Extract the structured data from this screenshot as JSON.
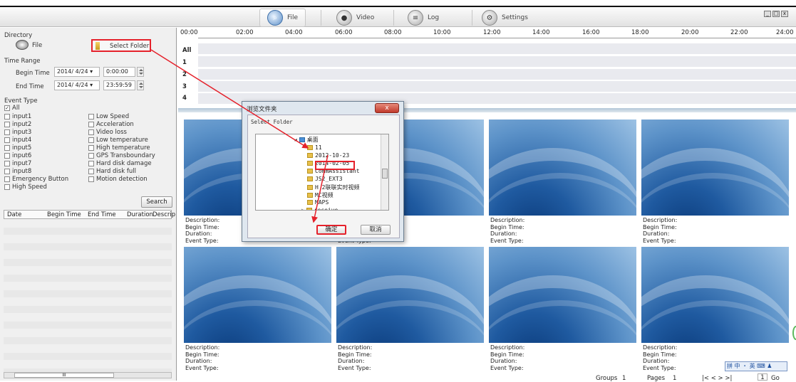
{
  "toolbar": {
    "tabs": [
      {
        "label": "File",
        "active": true
      },
      {
        "label": "Video"
      },
      {
        "label": "Log"
      },
      {
        "label": "Settings"
      }
    ]
  },
  "left": {
    "directory_label": "Directory",
    "file_label": "File",
    "select_folder": "Select Folder",
    "time_range_label": "Time Range",
    "begin_label": "Begin Time",
    "begin_date": "2014/ 4/24",
    "begin_time": "0:00:00",
    "end_label": "End Time",
    "end_date": "2014/ 4/24",
    "end_time": "23:59:59",
    "event_type_label": "Event Type",
    "all": "All",
    "events_col1": [
      "input1",
      "input2",
      "input3",
      "input4",
      "input5",
      "input6",
      "input7",
      "input8",
      "Emergency Button",
      "High Speed"
    ],
    "events_col2": [
      "Low Speed",
      "Acceleration",
      "Video loss",
      "Low temperature",
      "High temperature",
      "GPS Transboundary",
      "Hard disk damage",
      "Hard disk full",
      "Motion detection"
    ],
    "search": "Search",
    "table_headers": [
      "Date",
      "Begin Time",
      "End Time",
      "Duration",
      "Descrip"
    ],
    "scroll_mark": "III"
  },
  "timeline": {
    "ticks": [
      "00:00",
      "02:00",
      "04:00",
      "06:00",
      "08:00",
      "10:00",
      "12:00",
      "14:00",
      "16:00",
      "18:00",
      "20:00",
      "22:00",
      "24:00"
    ],
    "rows": [
      "All",
      "1",
      "2",
      "3",
      "4"
    ]
  },
  "thumbs": {
    "description": "Description:",
    "begin": "Begin Time:",
    "duration": "Duration:",
    "event": "Event Type:"
  },
  "dialog": {
    "title": "浏览文件夹",
    "close": "x",
    "subtitle": "Select Folder",
    "tree": [
      "桌面",
      "11",
      "2012-10-23",
      "2014-02-05",
      "CommAssistant",
      "JS2_EXT3",
      "H 2联联实时视频",
      "MC视频",
      "MAPS",
      "receive",
      "...."
    ],
    "ok": "确定",
    "cancel": "取消"
  },
  "footer": {
    "groups_label": "Groups",
    "groups_value": "1",
    "pages_label": "Pages",
    "pages_value": "1",
    "nav": "|<  <  >  >|",
    "page_input": "1",
    "go": "Go"
  },
  "ime": "拼 中 ・ 英 ⌨ ♟"
}
